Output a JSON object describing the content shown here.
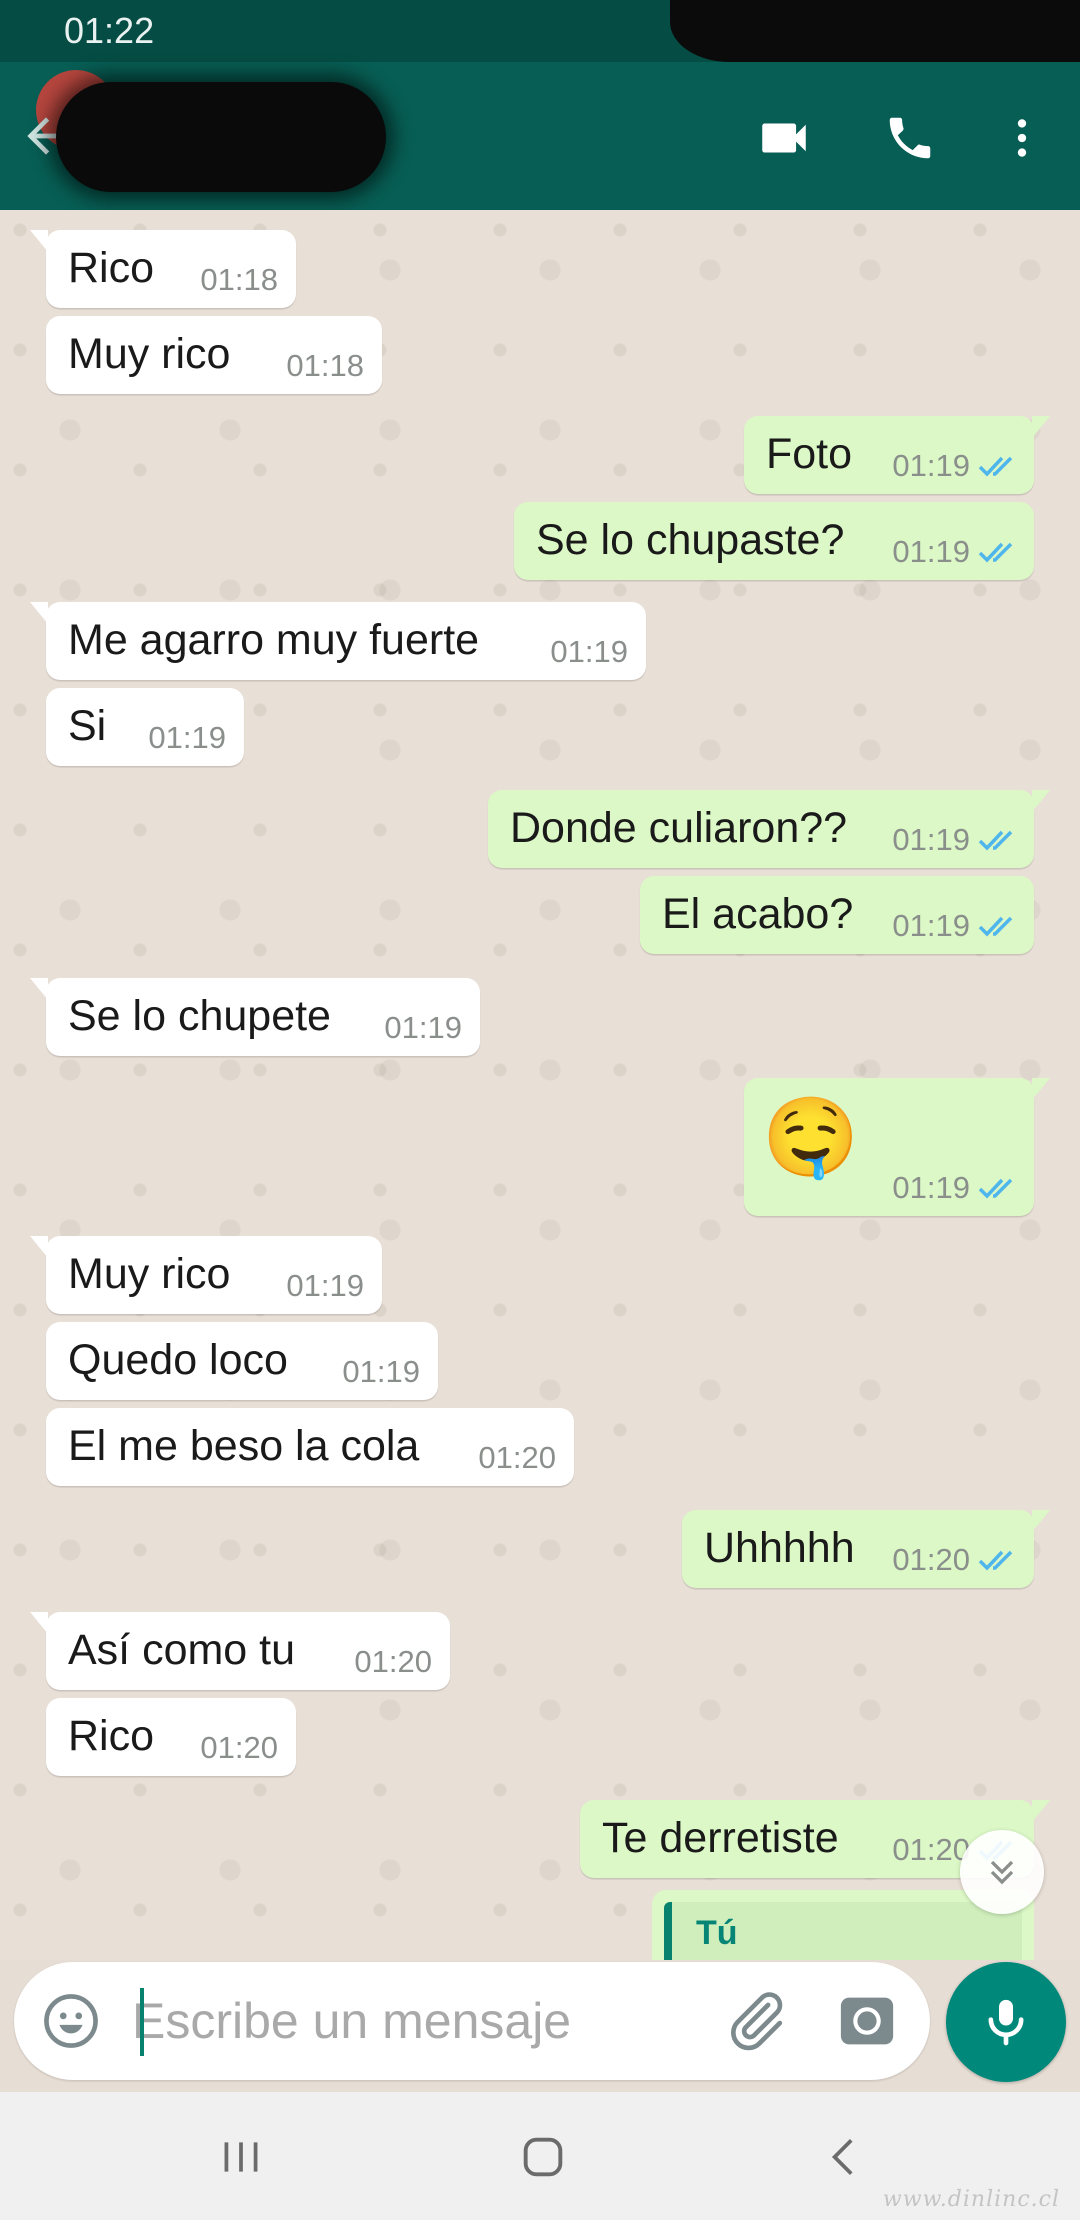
{
  "status_bar": {
    "time": "01:22"
  },
  "colors": {
    "header": "#075e54",
    "outgoing": "#dcf8c6",
    "incoming": "#ffffff",
    "accent": "#00897b",
    "read_ticks": "#4fb6ec"
  },
  "header": {
    "icons": [
      "back-arrow-icon",
      "video-call-icon",
      "phone-icon",
      "more-vert-icon"
    ]
  },
  "messages": [
    {
      "dir": "in",
      "text": "Rico",
      "time": "01:18"
    },
    {
      "dir": "in",
      "text": "Muy rico",
      "time": "01:18"
    },
    {
      "dir": "out",
      "text": "Foto",
      "time": "01:19",
      "status": "read"
    },
    {
      "dir": "out",
      "text": "Se lo chupaste?",
      "time": "01:19",
      "status": "read"
    },
    {
      "dir": "in",
      "text": "Me agarro muy fuerte",
      "time": "01:19"
    },
    {
      "dir": "in",
      "text": "Si",
      "time": "01:19"
    },
    {
      "dir": "out",
      "text": "Donde culiaron??",
      "time": "01:19",
      "status": "read"
    },
    {
      "dir": "out",
      "text": "El acabo?",
      "time": "01:19",
      "status": "read"
    },
    {
      "dir": "in",
      "text": "Se lo chupete",
      "time": "01:19"
    },
    {
      "dir": "out",
      "text": "🤤",
      "time": "01:19",
      "status": "read"
    },
    {
      "dir": "in",
      "text": "Muy rico",
      "time": "01:19"
    },
    {
      "dir": "in",
      "text": "Quedo loco",
      "time": "01:19"
    },
    {
      "dir": "in",
      "text": "El me beso la cola",
      "time": "01:20"
    },
    {
      "dir": "out",
      "text": "Uhhhhh",
      "time": "01:20",
      "status": "read"
    },
    {
      "dir": "in",
      "text": "Así como tu",
      "time": "01:20"
    },
    {
      "dir": "in",
      "text": "Rico",
      "time": "01:20"
    },
    {
      "dir": "out",
      "text": "Te derretiste",
      "time": "01:20",
      "status": "read"
    }
  ],
  "quoted_reply": {
    "author": "Tú"
  },
  "composer": {
    "placeholder": "Escribe un mensaje"
  },
  "watermark": "www.dinlinc.cl"
}
